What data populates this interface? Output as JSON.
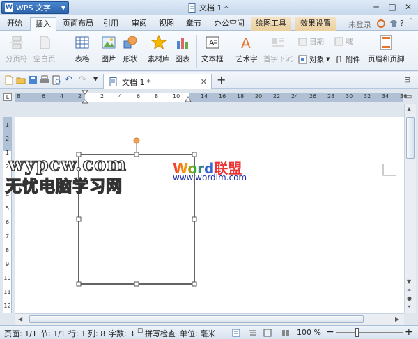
{
  "app": {
    "menu_label": "WPS 文字",
    "doc_title": "文档 1 *",
    "login": "未登录"
  },
  "tabs": [
    {
      "label": "开始"
    },
    {
      "label": "插入",
      "active": true
    },
    {
      "label": "页面布局"
    },
    {
      "label": "引用"
    },
    {
      "label": "审阅"
    },
    {
      "label": "视图"
    },
    {
      "label": "章节"
    },
    {
      "label": "办公空间"
    },
    {
      "label": "绘图工具",
      "contextual": true
    },
    {
      "label": "效果设置",
      "contextual": true
    }
  ],
  "ribbon": {
    "page_break": "分页符",
    "blank_page": "空白页",
    "table": "表格",
    "picture": "图片",
    "shapes": "形状",
    "material": "素材库",
    "chart": "图表",
    "textbox": "文本框",
    "wordart": "艺术字",
    "dropcap": "首字下沉",
    "date": "日期",
    "field": "域",
    "object": "对象",
    "attachment": "附件",
    "header_footer": "页眉和页脚"
  },
  "doc_tab": {
    "label": "文档 1 *"
  },
  "ruler": {
    "h_ticks": [
      "8",
      "6",
      "4",
      "2",
      "2",
      "4",
      "6",
      "8",
      "10",
      "14",
      "16",
      "18",
      "20",
      "22",
      "24",
      "26",
      "28",
      "30",
      "32",
      "34",
      "36",
      "38"
    ],
    "v_ticks": [
      "1",
      "2",
      "1",
      "2",
      "3",
      "4",
      "5",
      "6",
      "7",
      "8",
      "9",
      "10",
      "11",
      "12"
    ]
  },
  "watermark": {
    "line1": "wypcw.com",
    "line2": "无忧电脑学习网",
    "logo_word": "Word",
    "logo_cn": "联盟",
    "logo_url": "www.wordlm.com"
  },
  "status": {
    "page": "页面: 1/1",
    "section": "节: 1/1",
    "row": "行: 1",
    "col": "列: 8",
    "words": "字数: 3",
    "spell": "拼写检查",
    "unit": "单位: 毫米",
    "zoom": "100 %"
  },
  "colors": {
    "accent": "#2b62ab",
    "contextual_tab": "#ebcf9c",
    "rotation_handle": "#f0a050"
  }
}
